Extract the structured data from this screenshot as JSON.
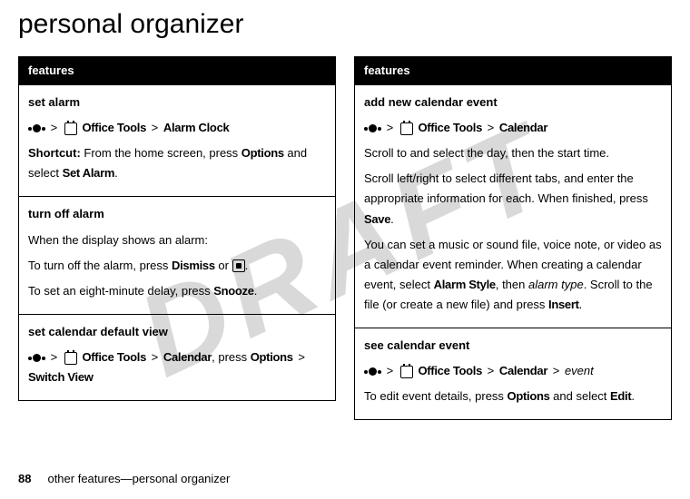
{
  "watermark": "DRAFT",
  "title": "personal organizer",
  "features_header": "features",
  "left": {
    "set_alarm": {
      "title": "set alarm",
      "path1": "Office Tools",
      "path2": "Alarm Clock",
      "shortcut_label": "Shortcut:",
      "shortcut_text": " From the home screen, press ",
      "options": "Options",
      "shortcut_text2": " and select ",
      "set_alarm_cmd": "Set Alarm",
      "period": "."
    },
    "turn_off": {
      "title": "turn off alarm",
      "line1": "When the display shows an alarm:",
      "line2a": "To turn off the alarm, press ",
      "dismiss": "Dismiss",
      "or": " or ",
      "period": ".",
      "line3a": "To set an eight-minute delay, press ",
      "snooze": "Snooze"
    },
    "default_view": {
      "title": "set calendar default view",
      "path1": "Office Tools",
      "path2": "Calendar",
      "press": ", press ",
      "options": "Options",
      "switch": "Switch View"
    }
  },
  "right": {
    "add_event": {
      "title": "add new calendar event",
      "path1": "Office Tools",
      "path2": "Calendar",
      "p1": "Scroll to and select the day, then the start time.",
      "p2a": "Scroll left/right to select different tabs, and enter the appropriate information for each. When finished, press ",
      "save": "Save",
      "period": ".",
      "p3a": "You can set a music or sound file, voice note, or video as a calendar event reminder. When creating a calendar event, select ",
      "alarm_style": "Alarm Style",
      "p3b": ", then ",
      "alarm_type": "alarm type",
      "p3c": ". Scroll to the file (or create a new file) and press ",
      "insert": "Insert"
    },
    "see_event": {
      "title": "see calendar event",
      "path1": "Office Tools",
      "path2": "Calendar",
      "event": "event",
      "p1a": "To edit event details, press ",
      "options": "Options",
      "p1b": " and select ",
      "edit": "Edit",
      "period": "."
    }
  },
  "footer": {
    "page": "88",
    "text": "other features—personal organizer"
  },
  "sym": {
    "gt": ">"
  }
}
